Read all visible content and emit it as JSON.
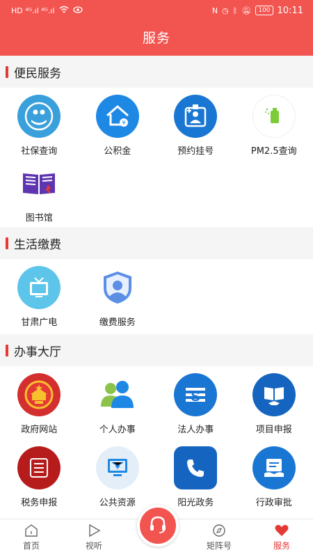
{
  "status_bar": {
    "carrier_icons": "HD ⁴ᴳ.ıl ⁴ᴳ.ıl",
    "battery": "100",
    "time": "10:11"
  },
  "header": {
    "title": "服务"
  },
  "sections": [
    {
      "title": "便民服务",
      "items": [
        {
          "label": "社保查询",
          "icon": "social-security-icon"
        },
        {
          "label": "公积金",
          "icon": "housing-fund-icon"
        },
        {
          "label": "预约挂号",
          "icon": "doctor-appointment-icon"
        },
        {
          "label": "PM2.5查询",
          "icon": "air-quality-icon"
        },
        {
          "label": "图书馆",
          "icon": "library-book-icon"
        }
      ]
    },
    {
      "title": "生活缴费",
      "items": [
        {
          "label": "甘肃广电",
          "icon": "tv-icon"
        },
        {
          "label": "缴费服务",
          "icon": "user-shield-icon"
        }
      ]
    },
    {
      "title": "办事大厅",
      "items": [
        {
          "label": "政府网站",
          "icon": "national-emblem-icon"
        },
        {
          "label": "个人办事",
          "icon": "people-icon"
        },
        {
          "label": "法人办事",
          "icon": "legal-s-icon"
        },
        {
          "label": "项目申报",
          "icon": "project-book-icon"
        },
        {
          "label": "税务申报",
          "icon": "tax-seal-icon"
        },
        {
          "label": "公共资源",
          "icon": "monitor-network-icon"
        },
        {
          "label": "阳光政务",
          "icon": "phone-icon"
        },
        {
          "label": "行政审批",
          "icon": "approval-icon"
        }
      ]
    }
  ],
  "tabbar": [
    {
      "label": "首页",
      "icon": "home-icon"
    },
    {
      "label": "视听",
      "icon": "play-icon"
    },
    {
      "label": "",
      "icon": "headset-icon"
    },
    {
      "label": "矩阵号",
      "icon": "compass-icon"
    },
    {
      "label": "服务",
      "icon": "heart-service-icon"
    }
  ],
  "colors": {
    "brand": "#f25550",
    "accent": "#e53935"
  }
}
